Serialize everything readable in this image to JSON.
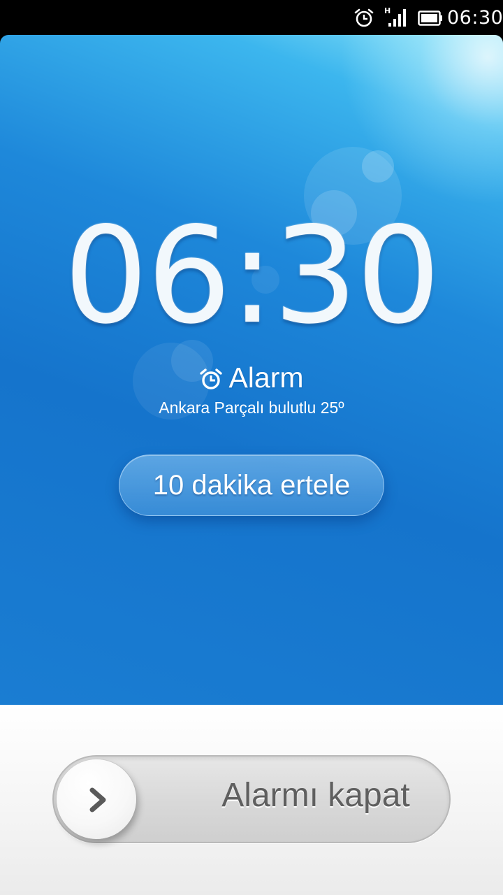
{
  "status_bar": {
    "time": "06:30",
    "network_type": "H",
    "icons": [
      "alarm-clock-icon",
      "signal-icon",
      "battery-icon"
    ]
  },
  "alarm": {
    "time": "06:30",
    "label": "Alarm",
    "weather": "Ankara Parçalı bulutlu 25º",
    "snooze_label": "10 dakika ertele",
    "dismiss_label": "Alarmı kapat"
  },
  "colors": {
    "accent_blue": "#1e88da",
    "light_blue": "#8be3f8",
    "dismiss_text": "#5f5f5f"
  }
}
